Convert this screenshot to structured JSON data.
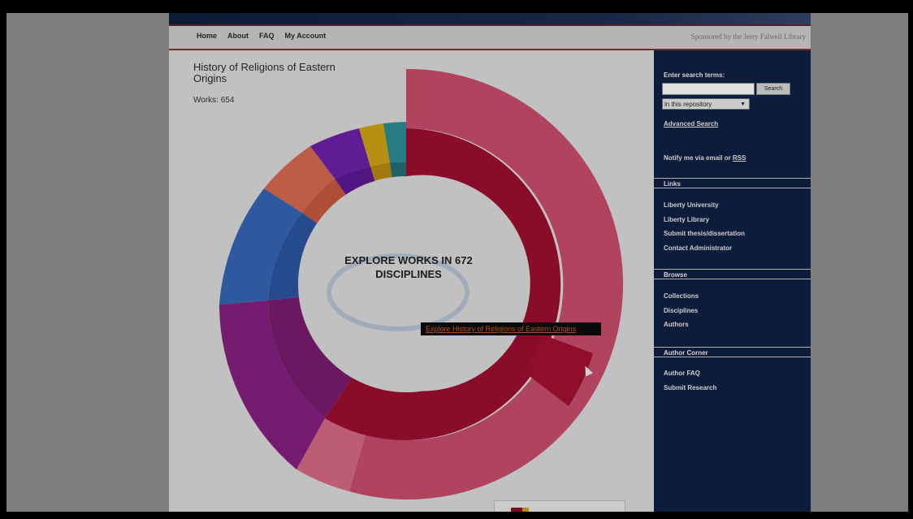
{
  "nav": {
    "links": [
      "Home",
      "About",
      "FAQ",
      "My Account"
    ],
    "sponsor": "Sponsored by the Jerry Falwell Library"
  },
  "chart": {
    "title": "History of Religions of Eastern Origins",
    "works": "Works: 654",
    "center_label": "EXPLORE WORKS IN 672 DISCIPLINES",
    "tooltip": "Explore History of Religions of Eastern Origins"
  },
  "sidebar": {
    "search_label": "Enter search terms:",
    "search_button": "Search",
    "scope": "in this repository",
    "advanced_search": "Advanced Search",
    "notify_prefix": "Notify me via email or ",
    "notify_rss": "RSS",
    "sections": [
      {
        "title": "Links",
        "items": [
          "Liberty University",
          "Liberty Library",
          "Submit thesis/dissertation",
          "Contact Administrator"
        ]
      },
      {
        "title": "Browse",
        "items": [
          "Collections",
          "Disciplines",
          "Authors"
        ]
      },
      {
        "title": "Author Corner",
        "items": [
          "Author FAQ",
          "Submit Research"
        ]
      }
    ]
  },
  "colors": {
    "crimson": "#9c0f2f",
    "pink": "#c94e6b",
    "magenta": "#86237f",
    "blue": "#2d5aa8",
    "sidebar": "#0f2044"
  }
}
